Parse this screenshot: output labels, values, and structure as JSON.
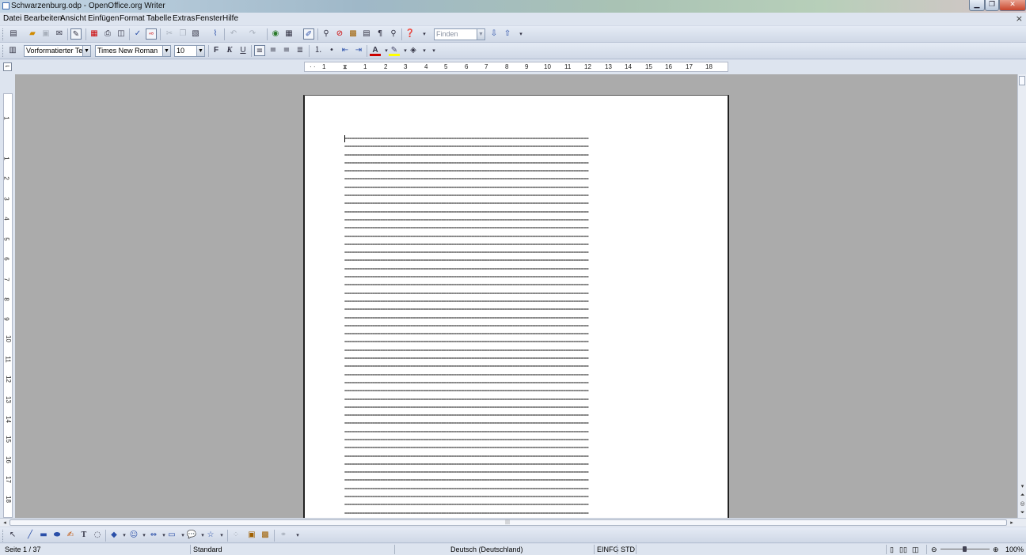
{
  "window": {
    "title": "Schwarzenburg.odp - OpenOffice.org Writer",
    "controls": {
      "minimize": "▁",
      "maximize": "❐",
      "close": "✕"
    }
  },
  "menu": {
    "items": [
      "Datei",
      "Bearbeiten",
      "Ansicht",
      "Einfügen",
      "Format",
      "Tabelle",
      "Extras",
      "Fenster",
      "Hilfe"
    ],
    "close_doc": "×"
  },
  "standard_toolbar": {
    "find_placeholder": "Finden",
    "icons": [
      "new-icon",
      "open-icon",
      "save-icon",
      "email-icon",
      "edit-mode-icon",
      "pdf-export-icon",
      "print-icon",
      "page-preview-icon",
      "spellcheck-icon",
      "autospell-icon",
      "cut-icon",
      "copy-icon",
      "paste-icon",
      "format-paintbrush-icon",
      "undo-icon",
      "redo-icon",
      "hyperlink-icon",
      "table-icon",
      "show-draw-functions-icon",
      "find-replace-icon",
      "navigator-icon",
      "gallery-icon",
      "data-sources-icon",
      "nonprinting-chars-icon",
      "zoom-icon",
      "help-icon",
      "find-next-icon",
      "find-prev-icon"
    ]
  },
  "formatting_toolbar": {
    "paragraph_style": "Vorformatierter Text",
    "font_name": "Times New Roman",
    "font_size": "10",
    "bold_label": "F",
    "italic_label": "K",
    "underline_label": "U",
    "font_color": "#cc0000",
    "highlight_color": "#ffff00"
  },
  "ruler": {
    "horizontal_ticks": [
      "1",
      "1",
      "2",
      "3",
      "4",
      "5",
      "6",
      "7",
      "8",
      "9",
      "10",
      "11",
      "12",
      "13",
      "14",
      "15",
      "16",
      "17",
      "18"
    ],
    "vertical_ticks": [
      "1",
      "1",
      "2",
      "3",
      "4",
      "5",
      "6",
      "7",
      "8",
      "9",
      "10",
      "11",
      "12",
      "13",
      "14",
      "15",
      "16",
      "17",
      "18"
    ]
  },
  "document": {
    "line_text": "================================================================================================",
    "line_count": 47
  },
  "statusbar": {
    "page": "Seite 1 / 37",
    "page_style": "Standard",
    "language": "Deutsch (Deutschland)",
    "insert_mode": "EINFG",
    "selection_mode": "STD",
    "zoom": "100%"
  }
}
